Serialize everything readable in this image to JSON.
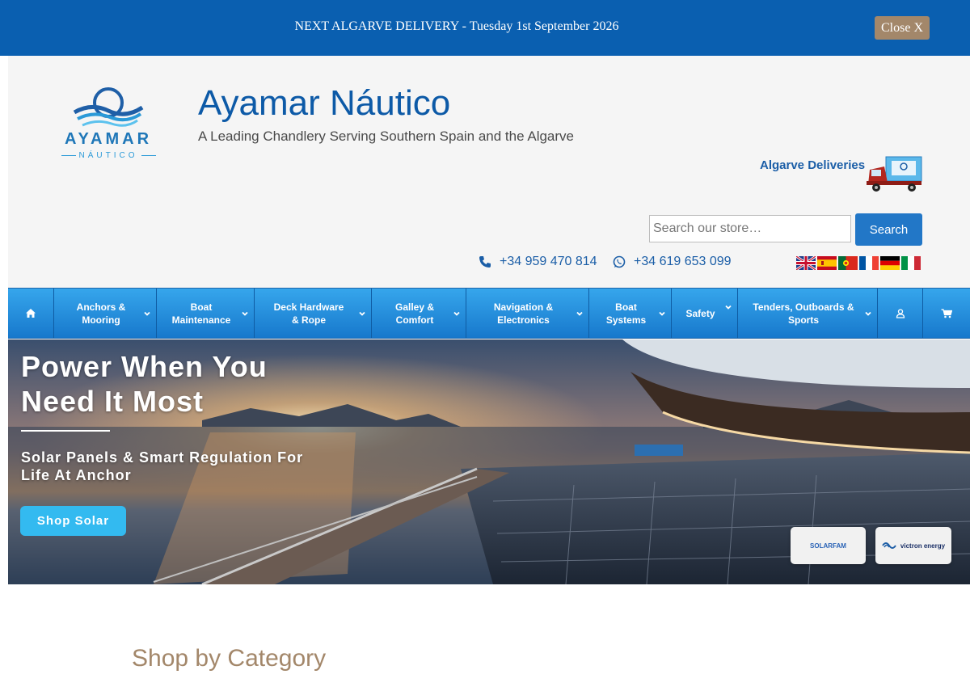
{
  "announcement": {
    "text": "NEXT ALGARVE DELIVERY - Tuesday 1st September 2026",
    "close_label": "Close X"
  },
  "header": {
    "logo_word": "AYAMAR",
    "logo_sub": "NÁUTICO",
    "title": "Ayamar Náutico",
    "tagline": "A Leading Chandlery Serving Southern Spain and the Algarve",
    "deliveries_label": "Algarve Deliveries",
    "search": {
      "placeholder": "Search our store…",
      "button_label": "Search"
    },
    "phones": [
      {
        "icon": "phone-icon",
        "number": "+34 959 470 814"
      },
      {
        "icon": "whatsapp-icon",
        "number": "+34 619 653 099"
      }
    ],
    "languages": [
      "English",
      "Español",
      "Português",
      "Français",
      "Deutsch",
      "Italiano"
    ]
  },
  "nav": {
    "home_icon": "home-icon",
    "items": [
      {
        "label": "Anchors & Mooring"
      },
      {
        "label": "Boat Maintenance"
      },
      {
        "label": "Deck Hardware & Rope"
      },
      {
        "label": "Galley & Comfort"
      },
      {
        "label": "Navigation & Electronics"
      },
      {
        "label": "Boat Systems"
      },
      {
        "label": "Safety"
      },
      {
        "label": "Tenders, Outboards & Sports"
      }
    ],
    "account_icon": "user-icon",
    "cart_icon": "cart-icon"
  },
  "hero": {
    "title": "Power When You Need It Most",
    "subtitle": "Solar Panels & Smart Regulation For Life At Anchor",
    "button_label": "Shop Solar",
    "brands": [
      "SOLARFAM",
      "victron energy"
    ]
  },
  "section": {
    "heading": "Shop by Category"
  },
  "colors": {
    "announcement_bg": "#0a5fb0",
    "close_bg": "#a3876a",
    "brand_blue": "#0d5aa7",
    "nav_top": "#36a6ec",
    "nav_bottom": "#1778cc",
    "accent_gold": "#a3876a",
    "cta_cyan": "#33baf0"
  }
}
